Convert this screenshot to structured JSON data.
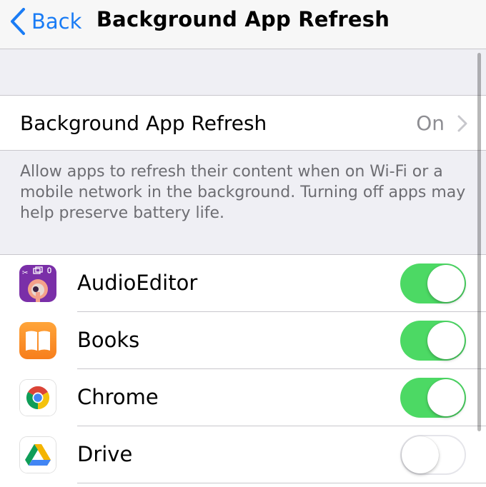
{
  "nav": {
    "back_label": "Back",
    "title": "Background App Refresh"
  },
  "setting": {
    "label": "Background App Refresh",
    "value": "On"
  },
  "footer_text": "Allow apps to refresh their content when on Wi-Fi or a mobile network in the background. Turning off apps may help preserve battery life.",
  "apps": [
    {
      "name": "AudioEditor",
      "icon": "audioeditor-app-icon",
      "enabled": true
    },
    {
      "name": "Books",
      "icon": "books-app-icon",
      "enabled": true
    },
    {
      "name": "Chrome",
      "icon": "chrome-app-icon",
      "enabled": true
    },
    {
      "name": "Drive",
      "icon": "drive-app-icon",
      "enabled": false
    }
  ],
  "colors": {
    "accent": "#1a7cf5",
    "toggle_on": "#4cd964",
    "background": "#efeff4",
    "secondary_text": "#8e8e93"
  }
}
